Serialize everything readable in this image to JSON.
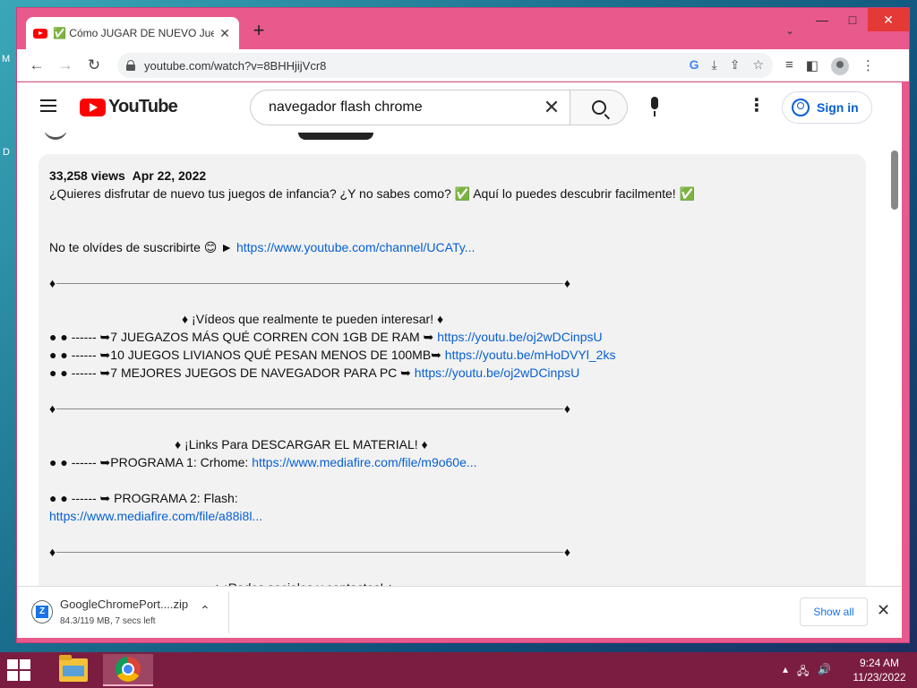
{
  "desktop": {
    "left_edge_letters": [
      "M",
      "D"
    ]
  },
  "browser": {
    "tab": {
      "title": "✅ Cómo JUGAR DE NUEVO Juegos",
      "close": "✕"
    },
    "new_tab": "+",
    "tab_search": "⌄",
    "window": {
      "minimize": "—",
      "maximize": "□",
      "close": "✕"
    },
    "nav": {
      "back": "←",
      "forward": "→",
      "reload": "↻"
    },
    "url": "youtube.com/watch?v=8BHHjijVcr8",
    "omnibox_icons": {
      "google": "G",
      "install": "⤓",
      "share": "⇪",
      "bookmark": "☆"
    },
    "toolbar_icons": {
      "media": "≡",
      "sidepanel": "◧",
      "menu": "⋮"
    }
  },
  "youtube": {
    "logo_text": "YouTube",
    "search_value": "navegador flash chrome",
    "search_clear": "✕",
    "kebab": "⋮",
    "signin_label": "Sign in"
  },
  "description": {
    "views": "33,258 views",
    "date": "Apr 22, 2022",
    "intro": "¿Quieres disfrutar de nuevo tus juegos de infancia? ¿Y no sabes como? ✅ Aquí lo puedes descubrir facilmente! ✅",
    "subscribe_text": "No te olvídes de suscribirte 😊 ► ",
    "subscribe_link": "https://www.youtube.com/channel/UCATy...",
    "videos_heading": "♦ ¡Vídeos que realmente te pueden interesar! ♦",
    "videos": [
      {
        "text": "● ● ------ ➥7 JUEGAZOS MÁS QUÉ CORREN CON 1GB DE RAM ➥ ",
        "link": "https://youtu.be/oj2wDCinpsU"
      },
      {
        "text": "● ● ------ ➥10 JUEGOS LIVIANOS QUÉ PESAN MENOS DE 100MB➥ ",
        "link": "https://youtu.be/mHoDVYl_2ks"
      },
      {
        "text": "● ● ------ ➥7 MEJORES JUEGOS DE NAVEGADOR PARA PC ➥ ",
        "link": "https://youtu.be/oj2wDCinpsU"
      }
    ],
    "links_heading": "♦ ¡Links Para DESCARGAR EL MATERIAL! ♦",
    "program1_text": "● ● ------ ➥PROGRAMA 1: Crhome: ",
    "program1_link": "https://www.mediafire.com/file/m9o60e...",
    "program2_text": "● ● ------ ➥ PROGRAMA 2: Flash:",
    "program2_link": "https://www.mediafire.com/file/a88i8l...",
    "social_heading": "♦ ¡Redes sociales y contactos! ♦",
    "divider_end": "♦"
  },
  "download": {
    "filename": "GoogleChromePort....zip",
    "status": "84.3/119 MB, 7 secs left",
    "icon_letter": "Z",
    "chevron": "⌃",
    "show_all": "Show all",
    "close": "✕"
  },
  "taskbar": {
    "time": "9:24 AM",
    "date": "11/23/2022",
    "tray": {
      "chevron": "▴",
      "network": "🖧",
      "volume": "🔊"
    }
  }
}
